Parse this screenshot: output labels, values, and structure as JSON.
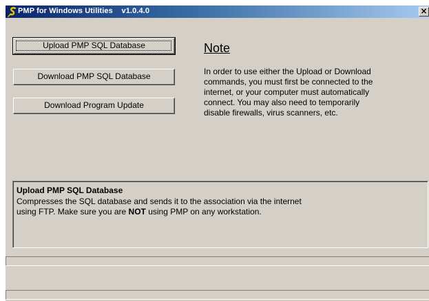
{
  "window": {
    "title": "PMP for Windows Utilities",
    "version": "v1.0.4.0",
    "close_glyph": "×",
    "title_bar_colors": [
      "#0a246a",
      "#a6caf0"
    ],
    "face_color": "#d4d0c8"
  },
  "buttons": {
    "upload": "Upload PMP SQL Database",
    "download": "Download PMP SQL Database",
    "update": "Download Program Update"
  },
  "note": {
    "title": "Note",
    "lines": [
      "In order to use either the Upload or Download",
      "commands, you must first be connected to the",
      "internet, or your computer must automatically",
      "connect. You may also need to temporarily",
      "disable firewalls, virus scanners, etc."
    ]
  },
  "description": {
    "title": "Upload PMP SQL Database",
    "line1": "Compresses the SQL database and sends it to the association via the internet",
    "line2_before": "using FTP. Make sure you are ",
    "line2_bold": "NOT",
    "line2_after": " using PMP on any workstation."
  },
  "icons": {
    "app": "pmp-logo-icon",
    "close": "close-icon"
  }
}
